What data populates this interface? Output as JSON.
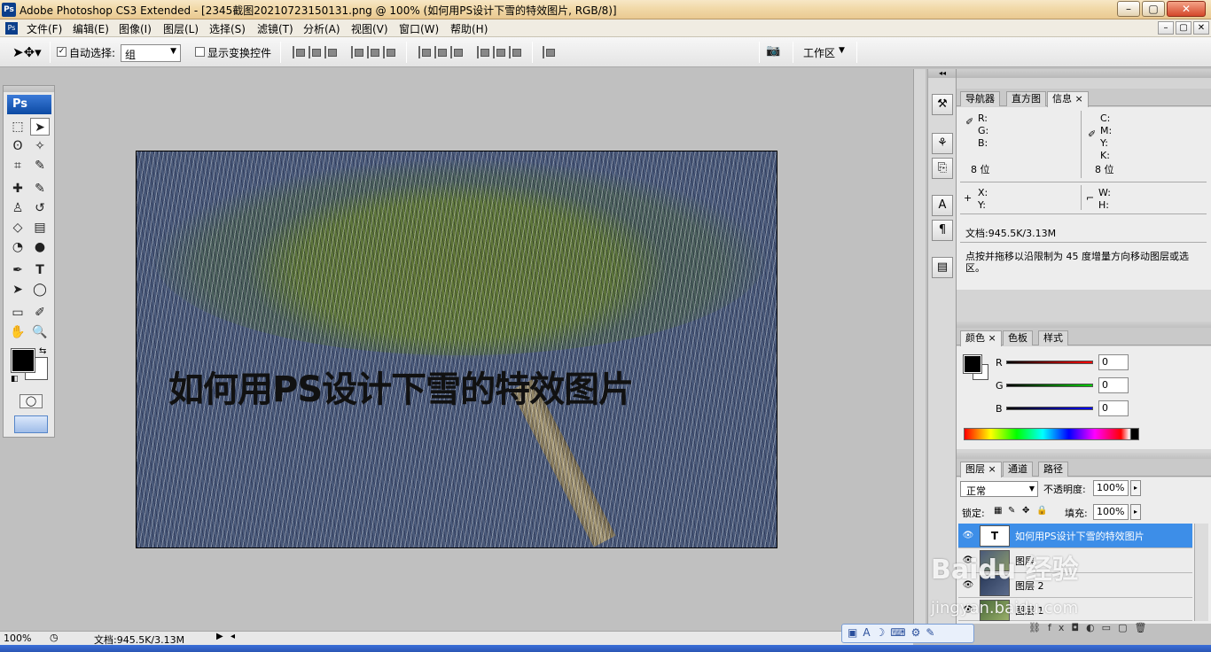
{
  "window": {
    "title": "Adobe Photoshop CS3 Extended - [2345截图20210723150131.png @ 100% (如何用PS设计下雪的特效图片, RGB/8)]",
    "app_icon": "Ps",
    "minimize": "–",
    "maximize": "▢",
    "close": "✕"
  },
  "menu": {
    "items": [
      "文件(F)",
      "编辑(E)",
      "图像(I)",
      "图层(L)",
      "选择(S)",
      "滤镜(T)",
      "分析(A)",
      "视图(V)",
      "窗口(W)",
      "帮助(H)"
    ],
    "doc_min": "–",
    "doc_restore": "▢",
    "doc_close": "✕"
  },
  "options": {
    "auto_select_label": "自动选择:",
    "auto_select_checked": "✓",
    "auto_select_value": "组",
    "show_transform_label": "显示变换控件",
    "workspace_label": "工作区"
  },
  "toolbox": {
    "logo": "Ps"
  },
  "canvas": {
    "caption": "如何用PS设计下雪的特效图片"
  },
  "info_panel": {
    "tabs": [
      "导航器",
      "直方图",
      "信息"
    ],
    "r": "R:",
    "g": "G:",
    "b": "B:",
    "c": "C:",
    "m": "M:",
    "y": "Y:",
    "k": "K:",
    "bits_left": "8 位",
    "bits_right": "8 位",
    "x": "X:",
    "y2": "Y:",
    "w": "W:",
    "h": "H:",
    "doc": "文档:945.5K/3.13M",
    "hint": "点按并拖移以沿限制为 45 度增量方向移动图层或选区。"
  },
  "color_panel": {
    "tabs": [
      "颜色",
      "色板",
      "样式"
    ],
    "r_label": "R",
    "g_label": "G",
    "b_label": "B",
    "r_value": "0",
    "g_value": "0",
    "b_value": "0"
  },
  "layers_panel": {
    "tabs": [
      "图层",
      "通道",
      "路径"
    ],
    "blend_mode": "正常",
    "opacity_label": "不透明度:",
    "opacity_value": "100%",
    "lock_label": "锁定:",
    "fill_label": "填充:",
    "fill_value": "100%",
    "layers": [
      {
        "name": "如何用PS设计下雪的特效图片",
        "thumb": "T",
        "selected": true
      },
      {
        "name": "图层",
        "thumb": "",
        "selected": false
      },
      {
        "name": "图层 2",
        "thumb": "",
        "selected": false
      },
      {
        "name": "图层 1",
        "thumb": "",
        "selected": false
      }
    ]
  },
  "statusbar": {
    "zoom": "100%",
    "doc": "文档:945.5K/3.13M"
  },
  "watermark": {
    "brand": "Baidu 经验",
    "url": "jingyan.baidu.com"
  },
  "colors": {
    "selection_blue": "#3d8ee8",
    "title_gradient": "#f1d9a8"
  }
}
